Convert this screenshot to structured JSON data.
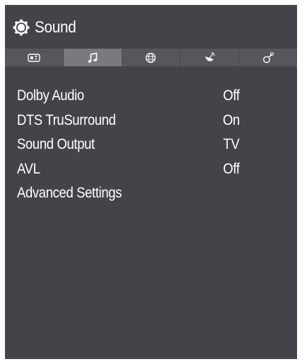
{
  "header": {
    "title": "Sound",
    "icon": "gear-icon"
  },
  "tabs": [
    {
      "icon": "picture-icon",
      "active": false
    },
    {
      "icon": "music-note-icon",
      "active": true
    },
    {
      "icon": "globe-icon",
      "active": false
    },
    {
      "icon": "satellite-dish-icon",
      "active": false
    },
    {
      "icon": "settings-tools-icon",
      "active": false
    }
  ],
  "settings": [
    {
      "label": "Dolby Audio",
      "value": "Off"
    },
    {
      "label": "DTS TruSurround",
      "value": "On"
    },
    {
      "label": "Sound Output",
      "value": "TV"
    },
    {
      "label": "AVL",
      "value": "Off"
    },
    {
      "label": "Advanced Settings",
      "value": ""
    }
  ],
  "colors": {
    "background": "#454349",
    "tabbar": "#58565c",
    "active_tab": "#7b797f",
    "text": "#ffffff"
  }
}
